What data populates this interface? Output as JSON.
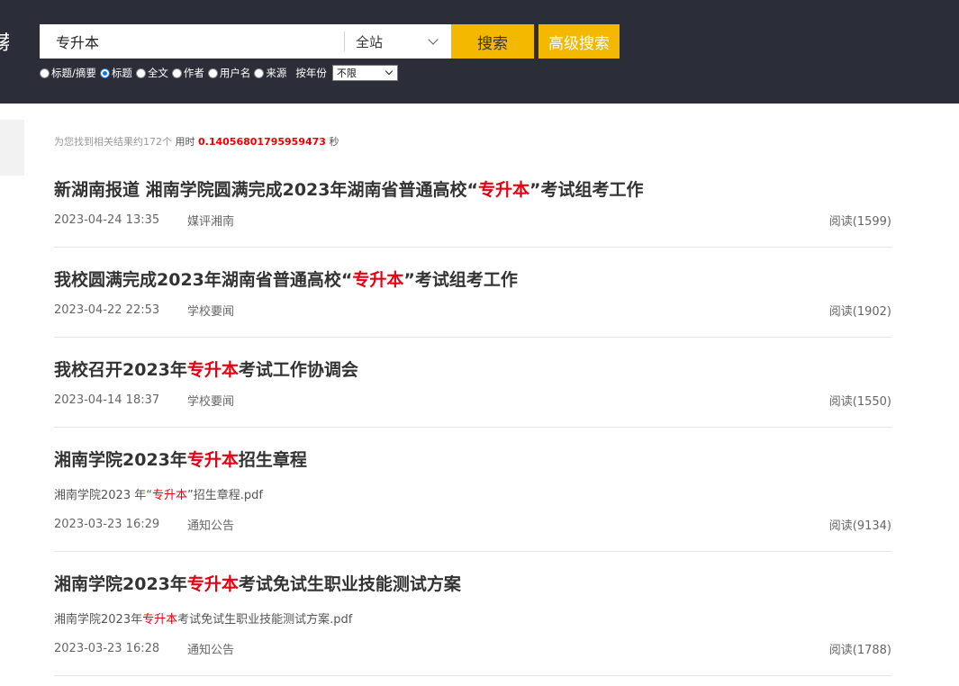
{
  "header": {
    "brand_glyph": "索",
    "search": {
      "value": "专升本",
      "placeholder": ""
    },
    "scope": {
      "selected": "全站"
    },
    "search_button": "搜索",
    "advanced_button": "高级搜索",
    "options": [
      {
        "label": "标题/摘要",
        "checked": false
      },
      {
        "label": "标题",
        "checked": true
      },
      {
        "label": "全文",
        "checked": false
      },
      {
        "label": "作者",
        "checked": false
      },
      {
        "label": "用户名",
        "checked": false
      },
      {
        "label": "来源",
        "checked": false
      }
    ],
    "year_label": "按年份",
    "year_select": "不限"
  },
  "stats": {
    "found": "为您找到相关结果约172个",
    "time_label": "用时",
    "elapsed": "0.14056801795959473",
    "unit": "秒"
  },
  "results": [
    {
      "title_pre": "新湖南报道 湘南学院圆满完成2023年湖南省普通高校“",
      "title_hl": "专升本",
      "title_post": "”考试组考工作",
      "date": "2023-04-24 13:35",
      "source": "媒评湘南",
      "views": "阅读(1599)"
    },
    {
      "title_pre": "我校圆满完成2023年湖南省普通高校“",
      "title_hl": "专升本",
      "title_post": "”考试组考工作",
      "date": "2023-04-22 22:53",
      "source": "学校要闻",
      "views": "阅读(1902)"
    },
    {
      "title_pre": "我校召开2023年",
      "title_hl": "专升本",
      "title_post": "考试工作协调会",
      "date": "2023-04-14 18:37",
      "source": "学校要闻",
      "views": "阅读(1550)"
    },
    {
      "title_pre": "湘南学院2023年",
      "title_hl": "专升本",
      "title_post": "招生章程",
      "snippet_pre": "湘南学院2023 年“",
      "snippet_hl": "专升本",
      "snippet_post": "”招生章程.pdf",
      "date": "2023-03-23 16:29",
      "source": "通知公告",
      "views": "阅读(9134)"
    },
    {
      "title_pre": "湘南学院2023年",
      "title_hl": "专升本",
      "title_post": "考试免试生职业技能测试方案",
      "snippet_pre": "湘南学院2023年",
      "snippet_hl": "专升本",
      "snippet_post": "考试免试生职业技能测试方案.pdf",
      "date": "2023-03-23 16:28",
      "source": "通知公告",
      "views": "阅读(1788)"
    }
  ],
  "colors": {
    "header_bg": "#2b2e38",
    "accent": "#f5b800",
    "highlight": "#e60012"
  }
}
